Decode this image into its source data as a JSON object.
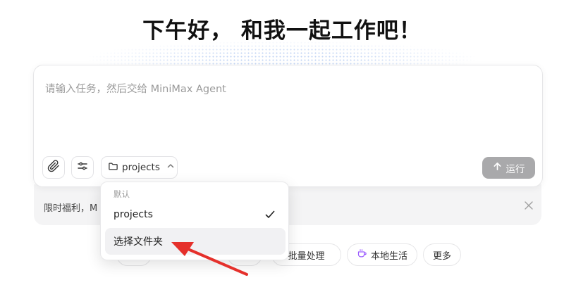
{
  "greeting": "下午好， 和我一起工作吧！",
  "input": {
    "placeholder": "请输入任务，然后交给 MiniMax Agent",
    "value": ""
  },
  "toolbar": {
    "attach_icon": "paperclip-icon",
    "settings_icon": "sliders-icon",
    "folder_label": "projects",
    "folder_icon": "folder-icon",
    "folder_chevron": "chevron-up-icon",
    "run_label": "运行",
    "run_icon": "arrow-up-icon"
  },
  "promo": {
    "text": "限时福利，M",
    "close_icon": "close-icon"
  },
  "dropdown": {
    "group_label": "默认",
    "items": [
      {
        "label": "projects",
        "selected": true
      },
      {
        "label": "选择文件夹",
        "selected": false
      }
    ]
  },
  "chips": [
    {
      "label": "批量处理",
      "icon": ""
    },
    {
      "label": "本地生活",
      "icon": "cup-icon"
    },
    {
      "label": "更多",
      "icon": ""
    }
  ],
  "colors": {
    "annotation_arrow": "#e5302b",
    "run_button": "#a9a9ab",
    "chip_icon": "#9b5cff"
  }
}
